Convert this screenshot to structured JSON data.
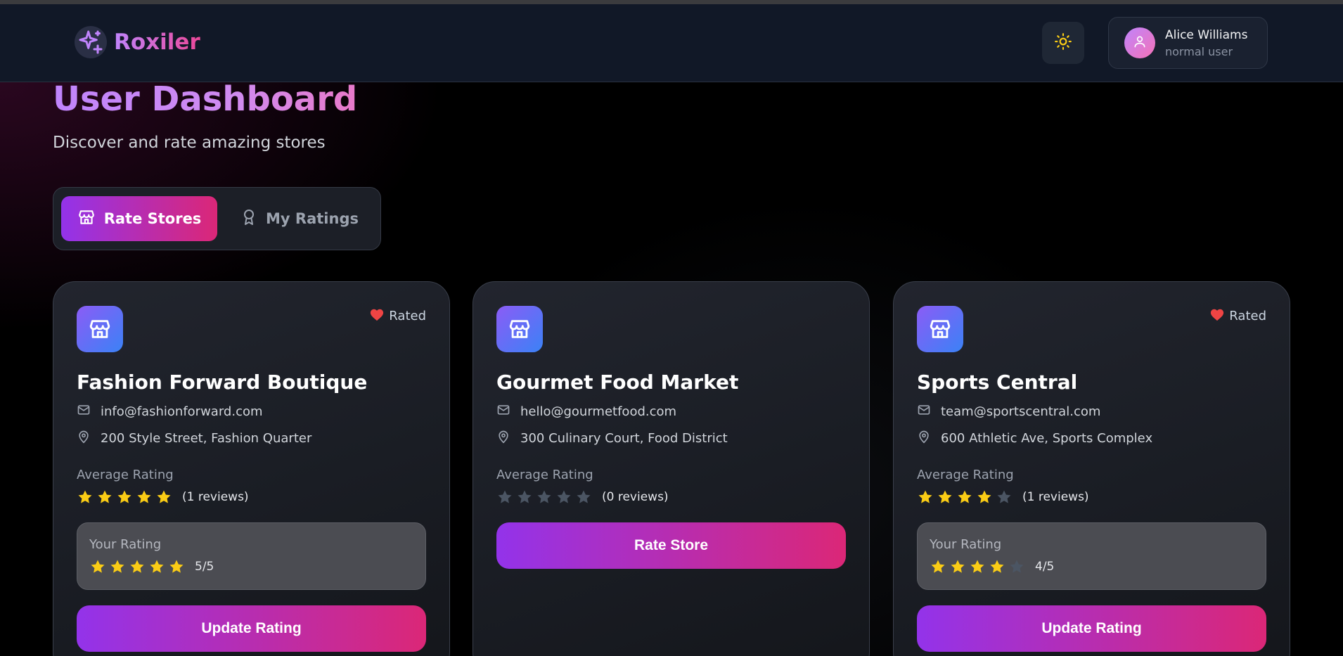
{
  "header": {
    "brand_name": "Roxiler",
    "user": {
      "name": "Alice Williams",
      "role": "normal user"
    }
  },
  "page": {
    "title": "User Dashboard",
    "subtitle": "Discover and rate amazing stores"
  },
  "tabs": [
    {
      "label": "Rate Stores",
      "active": true,
      "icon": "store-icon"
    },
    {
      "label": "My Ratings",
      "active": false,
      "icon": "award-icon"
    }
  ],
  "colors": {
    "accent_start": "#9333ea",
    "accent_end": "#db2777",
    "star_filled": "#facc15",
    "star_empty": "#4b5563",
    "rated_heart": "#ef4444"
  },
  "stores": [
    {
      "name": "Fashion Forward Boutique",
      "email": "info@fashionforward.com",
      "address": "200 Style Street, Fashion Quarter",
      "rated_label": "Rated",
      "avg_label": "Average Rating",
      "avg_rating": 5,
      "reviews_text": "(1 reviews)",
      "your_rating_label": "Your Rating",
      "your_rating": 5,
      "your_rating_text": "5/5",
      "button_label": "Update Rating"
    },
    {
      "name": "Gourmet Food Market",
      "email": "hello@gourmetfood.com",
      "address": "300 Culinary Court, Food District",
      "avg_label": "Average Rating",
      "avg_rating": 0,
      "reviews_text": "(0 reviews)",
      "button_label": "Rate Store"
    },
    {
      "name": "Sports Central",
      "email": "team@sportscentral.com",
      "address": "600 Athletic Ave, Sports Complex",
      "rated_label": "Rated",
      "avg_label": "Average Rating",
      "avg_rating": 4,
      "reviews_text": "(1 reviews)",
      "your_rating_label": "Your Rating",
      "your_rating": 4,
      "your_rating_text": "4/5",
      "button_label": "Update Rating"
    }
  ]
}
